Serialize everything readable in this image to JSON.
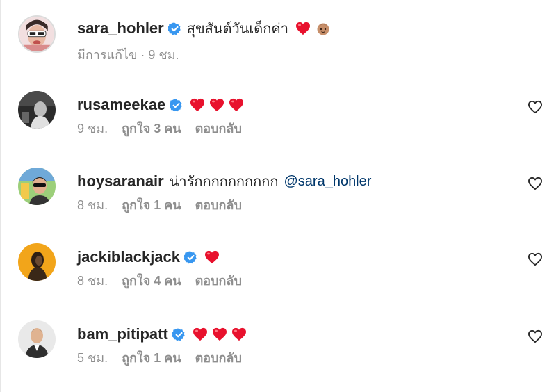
{
  "post_caption": {
    "username": "sara_hohler",
    "verified": true,
    "text": "สุขสันต์วันเด็กค่า",
    "meta": "มีการแก้ไข · 9 ชม."
  },
  "comments": [
    {
      "username": "rusameekae",
      "verified": true,
      "text": "",
      "mention": "",
      "hearts": 3,
      "time": "9 ชม.",
      "likes": "ถูกใจ 3 คน",
      "reply": "ตอบกลับ"
    },
    {
      "username": "hoysaranair",
      "verified": false,
      "text": "น่ารักกกกกกกกกก",
      "mention": "@sara_hohler",
      "hearts": 0,
      "time": "8 ชม.",
      "likes": "ถูกใจ 1 คน",
      "reply": "ตอบกลับ"
    },
    {
      "username": "jackiblackjack",
      "verified": true,
      "text": "",
      "mention": "",
      "hearts": 1,
      "time": "8 ชม.",
      "likes": "ถูกใจ 4 คน",
      "reply": "ตอบกลับ"
    },
    {
      "username": "bam_pitipatt",
      "verified": true,
      "text": "",
      "mention": "",
      "hearts": 3,
      "time": "5 ชม.",
      "likes": "ถูกใจ 1 คน",
      "reply": "ตอบกลับ"
    }
  ],
  "colors": {
    "text": "#262626",
    "secondary": "#8e8e8e",
    "verified_blue": "#3897f0",
    "mention_blue": "#00376b",
    "heart_red": "#e8112d"
  },
  "icons": {
    "verified": "verified-badge-icon",
    "heart_emoji": "red-heart-emoji",
    "baby_emoji": "baby-emoji",
    "like": "heart-outline-icon"
  }
}
